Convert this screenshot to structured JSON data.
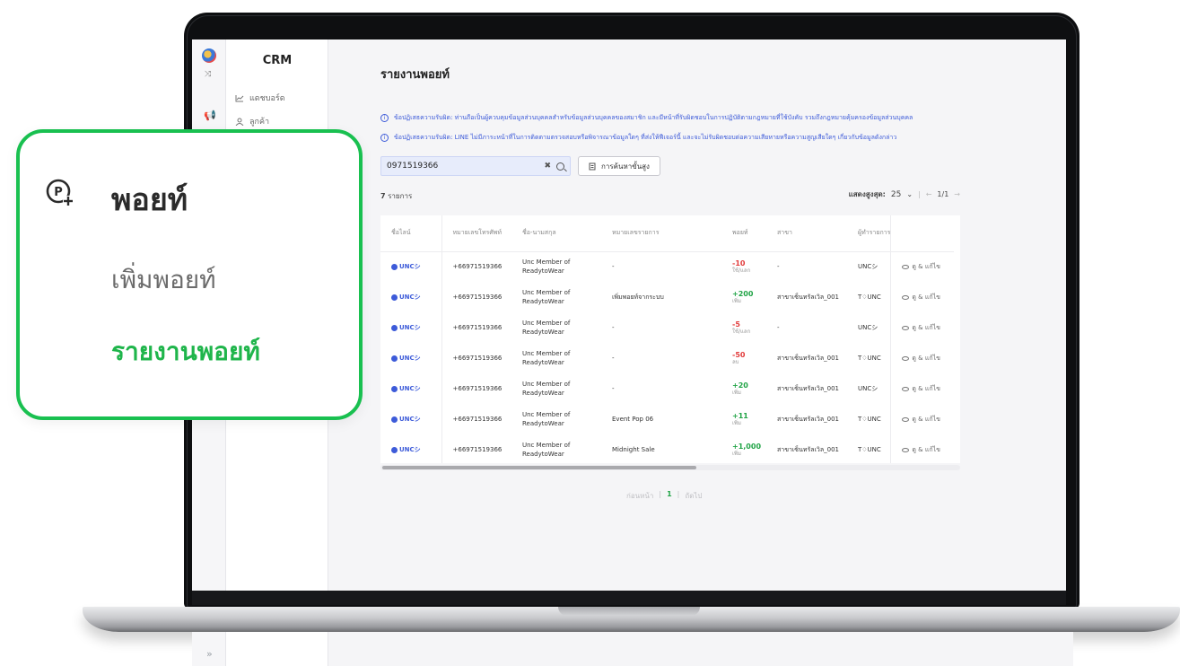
{
  "app": {
    "title": "CRM"
  },
  "sidebar": {
    "items": [
      {
        "label": "แดชบอร์ด",
        "icon": "chart-icon"
      },
      {
        "label": "ลูกค้า",
        "icon": "user-icon"
      }
    ]
  },
  "page": {
    "title": "รายงานพอยท์"
  },
  "notices": [
    "ข้อปฏิเสธความรับผิด: ท่านถือเป็นผู้ควบคุมข้อมูลส่วนบุคคลสำหรับข้อมูลส่วนบุคคลของสมาชิก และมีหน้าที่รับผิดชอบในการปฏิบัติตามกฎหมายที่ใช้บังคับ รวมถึงกฎหมายคุ้มครองข้อมูลส่วนบุคคล",
    "ข้อปฏิเสธความรับผิด: LINE ไม่มีภาระหน้าที่ในการติดตามตรวจสอบหรือพิจารณาข้อมูลใดๆ ที่ส่งให้ฟีเจอร์นี้ และจะไม่รับผิดชอบต่อความเสียหายหรือความสูญเสียใดๆ เกี่ยวกับข้อมูลดังกล่าว"
  ],
  "search": {
    "value": "0971519366",
    "advanced_label": "การค้นหาขั้นสูง"
  },
  "list": {
    "count": "7",
    "count_suffix": "รายการ",
    "page_size_label": "แสดงสูงสุด:",
    "page_size": "25",
    "page_info": "1/1"
  },
  "table": {
    "headers": [
      "ชื่อไลน์",
      "หมายเลขโทรศัพท์",
      "ชื่อ-นามสกุล",
      "หมายเลขรายการ",
      "พอยท์",
      "สาขา",
      "ผู้ทำรายการ"
    ],
    "rows": [
      {
        "line": "UNCシ",
        "phone": "+66971519366",
        "name1": "Unc Member of",
        "name2": "ReadytoWear",
        "ref": "-",
        "points": "-10",
        "type": "ใช้/แลก",
        "sign": "neg",
        "branch": "-",
        "by": "UNCシ",
        "action": "ดู & แก้ไข"
      },
      {
        "line": "UNCシ",
        "phone": "+66971519366",
        "name1": "Unc Member of",
        "name2": "ReadytoWear",
        "ref": "เพิ่มพอยท์จากระบบ",
        "points": "+200",
        "type": "เพิ่ม",
        "sign": "pos",
        "branch": "สาขาเซ็นทรัลเวิล_001",
        "by": "T♢UNC",
        "action": "ดู & แก้ไข"
      },
      {
        "line": "UNCシ",
        "phone": "+66971519366",
        "name1": "Unc Member of",
        "name2": "ReadytoWear",
        "ref": "-",
        "points": "-5",
        "type": "ใช้/แลก",
        "sign": "neg",
        "branch": "-",
        "by": "UNCシ",
        "action": "ดู & แก้ไข"
      },
      {
        "line": "UNCシ",
        "phone": "+66971519366",
        "name1": "Unc Member of",
        "name2": "ReadytoWear",
        "ref": "-",
        "points": "-50",
        "type": "ลบ",
        "sign": "neg",
        "branch": "สาขาเซ็นทรัลเวิล_001",
        "by": "T♢UNC",
        "action": "ดู & แก้ไข"
      },
      {
        "line": "UNCシ",
        "phone": "+66971519366",
        "name1": "Unc Member of",
        "name2": "ReadytoWear",
        "ref": "-",
        "points": "+20",
        "type": "เพิ่ม",
        "sign": "pos",
        "branch": "สาขาเซ็นทรัลเวิล_001",
        "by": "UNCシ",
        "action": "ดู & แก้ไข"
      },
      {
        "line": "UNCシ",
        "phone": "+66971519366",
        "name1": "Unc Member of",
        "name2": "ReadytoWear",
        "ref": "Event Pop 06",
        "points": "+11",
        "type": "เพิ่ม",
        "sign": "pos",
        "branch": "สาขาเซ็นทรัลเวิล_001",
        "by": "T♢UNC",
        "action": "ดู & แก้ไข"
      },
      {
        "line": "UNCシ",
        "phone": "+66971519366",
        "name1": "Unc Member of",
        "name2": "ReadytoWear",
        "ref": "Midnight Sale",
        "points": "+1,000",
        "type": "เพิ่ม",
        "sign": "pos",
        "branch": "สาขาเซ็นทรัลเวิล_001",
        "by": "T♢UNC",
        "action": "ดู & แก้ไข"
      }
    ]
  },
  "pagination": {
    "prev": "ก่อนหน้า",
    "current": "1",
    "next": "ถัดไป"
  },
  "callout": {
    "title": "พอยท์",
    "item_add": "เพิ่มพอยท์",
    "item_report": "รายงานพอยท์",
    "border_color": "#19c050",
    "active_color": "#1fb54b"
  },
  "colors": {
    "accent": "#3d5bd9",
    "negative": "#e23b3b",
    "positive": "#22a447"
  }
}
